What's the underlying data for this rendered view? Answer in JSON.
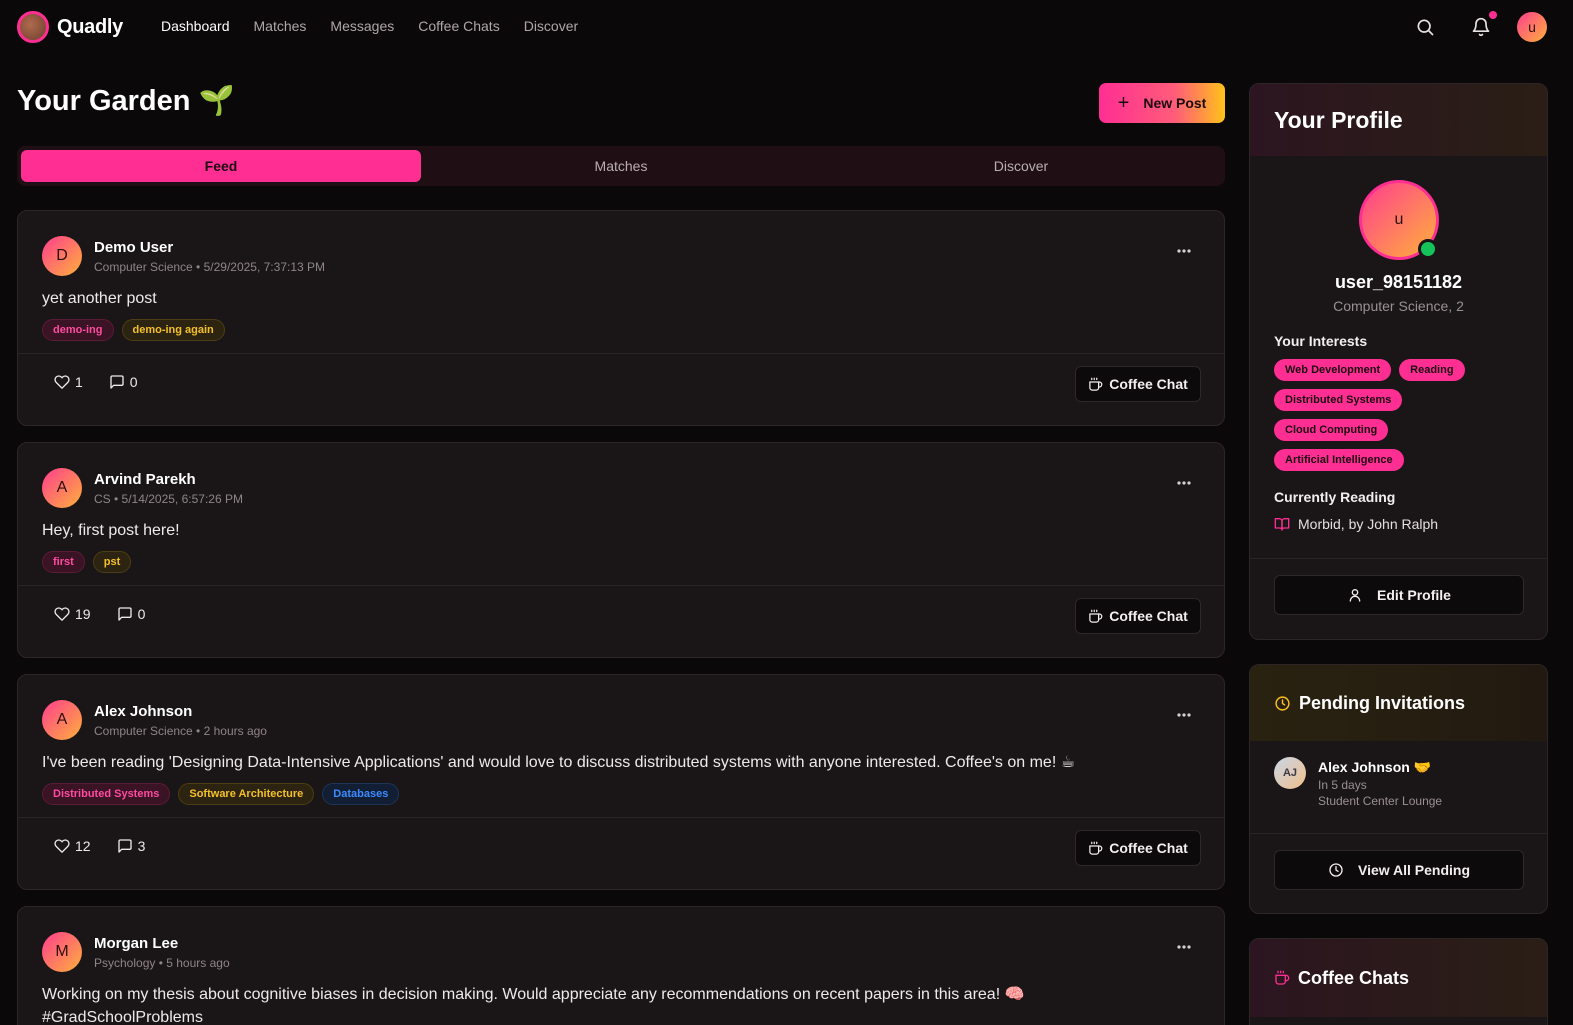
{
  "nav": {
    "brand": "Quadly",
    "links": [
      "Dashboard",
      "Matches",
      "Messages",
      "Coffee Chats",
      "Discover"
    ],
    "avatar_initial": "u",
    "has_notification": true
  },
  "header": {
    "title": "Your Garden",
    "title_emoji": "🌱",
    "new_post_label": "New Post",
    "new_post_icon": "+"
  },
  "tabs": [
    "Feed",
    "Matches",
    "Discover"
  ],
  "posts": [
    {
      "initial": "D",
      "name": "Demo User",
      "meta": "Computer Science • 5/29/2025, 7:37:13 PM",
      "content": "yet another post",
      "tags": [
        {
          "label": "demo-ing",
          "color": "pink"
        },
        {
          "label": "demo-ing again",
          "color": "gold"
        }
      ],
      "likes": "1",
      "comments": "0",
      "coffee_label": "Coffee Chat"
    },
    {
      "initial": "A",
      "name": "Arvind Parekh",
      "meta": "CS • 5/14/2025, 6:57:26 PM",
      "content": "Hey, first post here!",
      "tags": [
        {
          "label": "first",
          "color": "pink"
        },
        {
          "label": "pst",
          "color": "gold"
        }
      ],
      "likes": "19",
      "comments": "0",
      "coffee_label": "Coffee Chat"
    },
    {
      "initial": "A",
      "name": "Alex Johnson",
      "meta": "Computer Science • 2 hours ago",
      "content": "I've been reading 'Designing Data-Intensive Applications' and would love to discuss distributed systems with anyone interested. Coffee's on me! ☕",
      "tags": [
        {
          "label": "Distributed Systems",
          "color": "pink"
        },
        {
          "label": "Software Architecture",
          "color": "gold"
        },
        {
          "label": "Databases",
          "color": "blue"
        }
      ],
      "likes": "12",
      "comments": "3",
      "coffee_label": "Coffee Chat"
    },
    {
      "initial": "M",
      "name": "Morgan Lee",
      "meta": "Psychology • 5 hours ago",
      "content": "Working on my thesis about cognitive biases in decision making. Would appreciate any recommendations on recent papers in this area! 🧠 #GradSchoolProblems",
      "tags": [],
      "likes": "",
      "comments": "",
      "coffee_label": ""
    }
  ],
  "profile": {
    "title": "Your Profile",
    "avatar_initial": "u",
    "username": "user_98151182",
    "subtitle": "Computer Science, 2",
    "interests_label": "Your Interests",
    "interests": [
      "Web Development",
      "Reading",
      "Distributed Systems",
      "Cloud Computing",
      "Artificial Intelligence"
    ],
    "reading_label": "Currently Reading",
    "reading": "Morbid, by John Ralph",
    "edit_label": "Edit Profile"
  },
  "pending": {
    "title": "Pending Invitations",
    "invite": {
      "initials": "AJ",
      "name": "Alex Johnson 🤝",
      "when": "In 5 days",
      "where": "Student Center Lounge"
    },
    "view_all_label": "View All Pending"
  },
  "coffee_chats": {
    "title": "Coffee Chats"
  },
  "colors": {
    "accent": "#ff2e93",
    "gold": "#ffc21a",
    "background": "#0a0808",
    "card": "#1a1516"
  }
}
